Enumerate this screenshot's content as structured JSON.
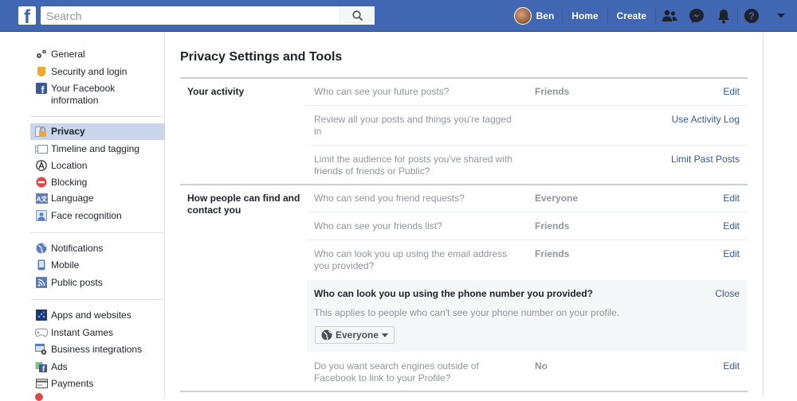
{
  "topbar": {
    "logo_letter": "f",
    "search_placeholder": "Search",
    "user_name": "Ben",
    "nav_links": [
      "Home",
      "Create"
    ],
    "brand_color": "#4267b2"
  },
  "sidebar": {
    "groups": [
      [
        {
          "label": "General",
          "icon": "gears-icon"
        },
        {
          "label": "Security and login",
          "icon": "badge-icon"
        },
        {
          "label": "Your Facebook information",
          "label_line1": "Your Facebook",
          "label_line2": "information",
          "icon": "facebook-icon"
        }
      ],
      [
        {
          "label": "Privacy",
          "icon": "lock-icon",
          "active": true
        },
        {
          "label": "Timeline and tagging",
          "icon": "timeline-icon"
        },
        {
          "label": "Location",
          "icon": "location-icon"
        },
        {
          "label": "Blocking",
          "icon": "blocking-icon"
        },
        {
          "label": "Language",
          "icon": "language-icon"
        },
        {
          "label": "Face recognition",
          "icon": "face-recognition-icon"
        }
      ],
      [
        {
          "label": "Notifications",
          "icon": "globe-icon"
        },
        {
          "label": "Mobile",
          "icon": "mobile-icon"
        },
        {
          "label": "Public posts",
          "icon": "rss-icon"
        }
      ],
      [
        {
          "label": "Apps and websites",
          "icon": "apps-icon"
        },
        {
          "label": "Instant Games",
          "icon": "gamepad-icon"
        },
        {
          "label": "Business integrations",
          "icon": "business-gear-icon"
        },
        {
          "label": "Ads",
          "icon": "ads-icon"
        },
        {
          "label": "Payments",
          "icon": "card-icon"
        }
      ]
    ]
  },
  "main": {
    "title": "Privacy Settings and Tools",
    "sections": [
      {
        "title": "Your activity",
        "rows": [
          {
            "question": "Who can see your future posts?",
            "value": "Friends",
            "action": "Edit"
          },
          {
            "question": "Review all your posts and things you're tagged in",
            "q1": "Review all your posts and things you're tagged",
            "q2": "in",
            "value": "",
            "action": "Use Activity Log"
          },
          {
            "question": "Limit the audience for posts you've shared with friends of friends or Public?",
            "q1": "Limit the audience for posts you've shared with",
            "q2": "friends of friends or Public?",
            "value": "",
            "action": "Limit Past Posts"
          }
        ]
      },
      {
        "title": "How people can find and contact you",
        "title1": "How people can find and",
        "title2": "contact you",
        "rows": [
          {
            "question": "Who can send you friend requests?",
            "value": "Everyone",
            "action": "Edit"
          },
          {
            "question": "Who can see your friends list?",
            "value": "Friends",
            "action": "Edit"
          },
          {
            "question": "Who can look you up using the email address you provided?",
            "q1": "Who can look you up using the email address",
            "q2": "you provided?",
            "value": "Friends",
            "action": "Edit"
          }
        ],
        "expanded": {
          "question": "Who can look you up using the phone number you provided?",
          "description": "This applies to people who can't see your phone number on your profile.",
          "close": "Close",
          "selected": "Everyone"
        },
        "last_row": {
          "question": "Do you want search engines outside of Facebook to link to your Profile?",
          "q1": "Do you want search engines outside of",
          "q2": "Facebook to link to your Profile?",
          "value": "No",
          "action": "Edit"
        }
      }
    ]
  }
}
